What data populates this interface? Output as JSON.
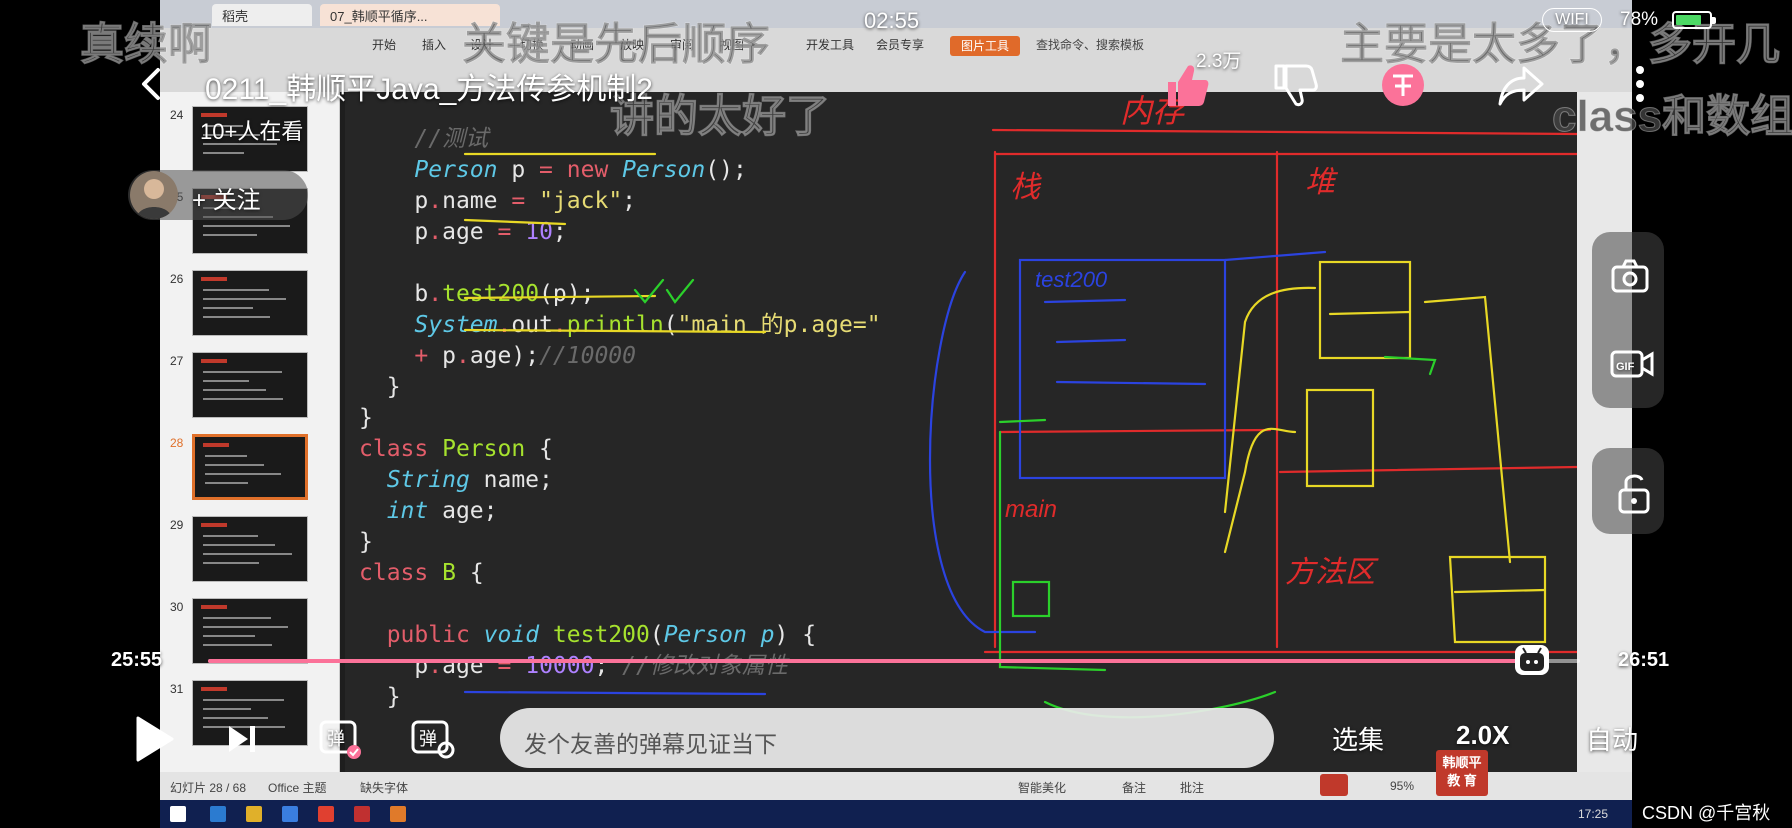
{
  "status_bar": {
    "time": "02:55",
    "wifi": "WIFI",
    "battery": "78%",
    "battery_level": 0.78
  },
  "player": {
    "title": "0211_韩顺平Java_方法传参机制2",
    "viewers": "10+人在看",
    "follow_label": "+ 关注",
    "like_count": "2.3万",
    "position_time": "25:55",
    "duration_time": "26:51",
    "progress": 0.965,
    "danmaku_placeholder": "发个友善的弹幕见证当下",
    "episodes_label": "选集",
    "speed_label": "2.0X",
    "auto_label": "自动",
    "colors": {
      "accent": "#fb7299",
      "coin": "#fb7299"
    }
  },
  "danmaku": [
    "真续啊",
    "关键是先后顺序",
    "讲的太好了",
    "主要是太多了，多开几",
    "class和数组"
  ],
  "ribbon": {
    "tabs": [
      "稻壳",
      "07_韩顺平循序..."
    ],
    "menu": [
      "开始",
      "插入",
      "设计",
      "切换",
      "动画",
      "放映",
      "审阅",
      "视图",
      "开发工具",
      "会员专享"
    ],
    "picture_tool": "图片工具",
    "search": "查找命令、搜索模板"
  },
  "thumbnails": {
    "numbers": [
      "24",
      "25",
      "26",
      "27",
      "28",
      "29",
      "30",
      "31"
    ],
    "active": "28"
  },
  "slide_status": {
    "slide": "幻灯片 28 / 68",
    "theme": "Office 主题",
    "font": "缺失字体",
    "beautify": "智能美化",
    "notes": "备注",
    "comments": "批注",
    "zoom": "95%"
  },
  "logo_badge": {
    "line1": "韩顺平",
    "line2": "教 育"
  },
  "taskbar": {
    "clock": "17:25"
  },
  "annotations": [
    "内存",
    "栈",
    "堆",
    "方法区",
    "main",
    "test200"
  ],
  "watermark": "CSDN @千宫秋"
}
